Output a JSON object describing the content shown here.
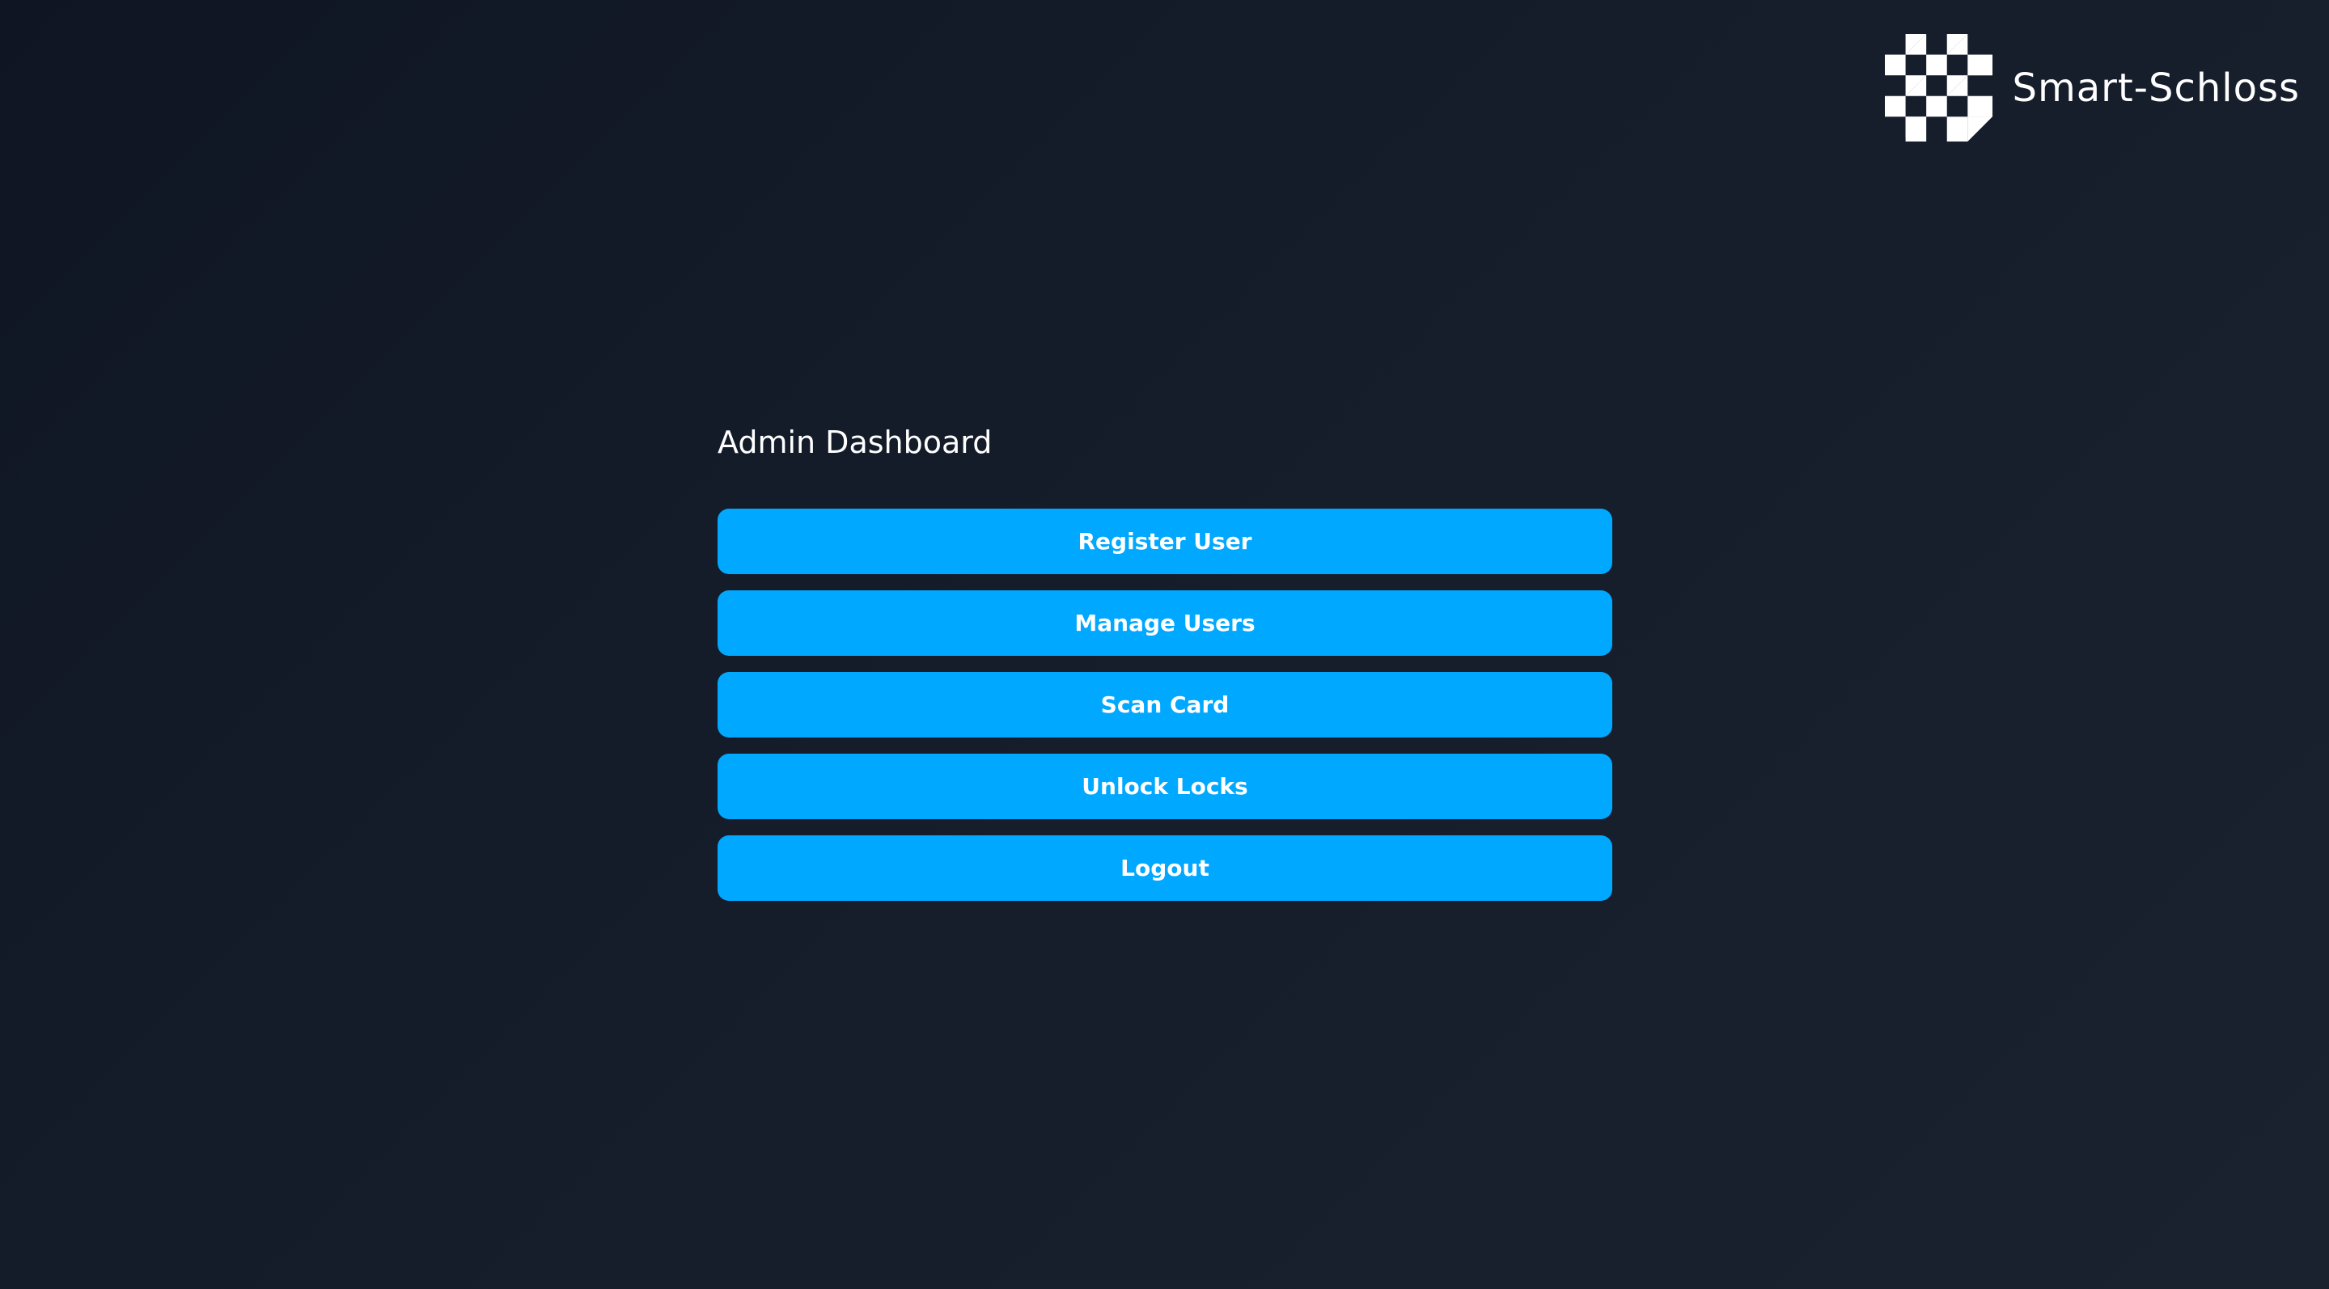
{
  "brand": {
    "name": "Smart-Schloss",
    "logo_icon": "checker-blocks-logo-icon"
  },
  "colors": {
    "accent": "#00a8ff",
    "background_start": "#0f1523",
    "background_end": "#1a2230",
    "text": "#ffffff"
  },
  "dashboard": {
    "title": "Admin Dashboard",
    "buttons": [
      {
        "label": "Register User"
      },
      {
        "label": "Manage Users"
      },
      {
        "label": "Scan Card"
      },
      {
        "label": "Unlock Locks"
      },
      {
        "label": "Logout"
      }
    ]
  }
}
